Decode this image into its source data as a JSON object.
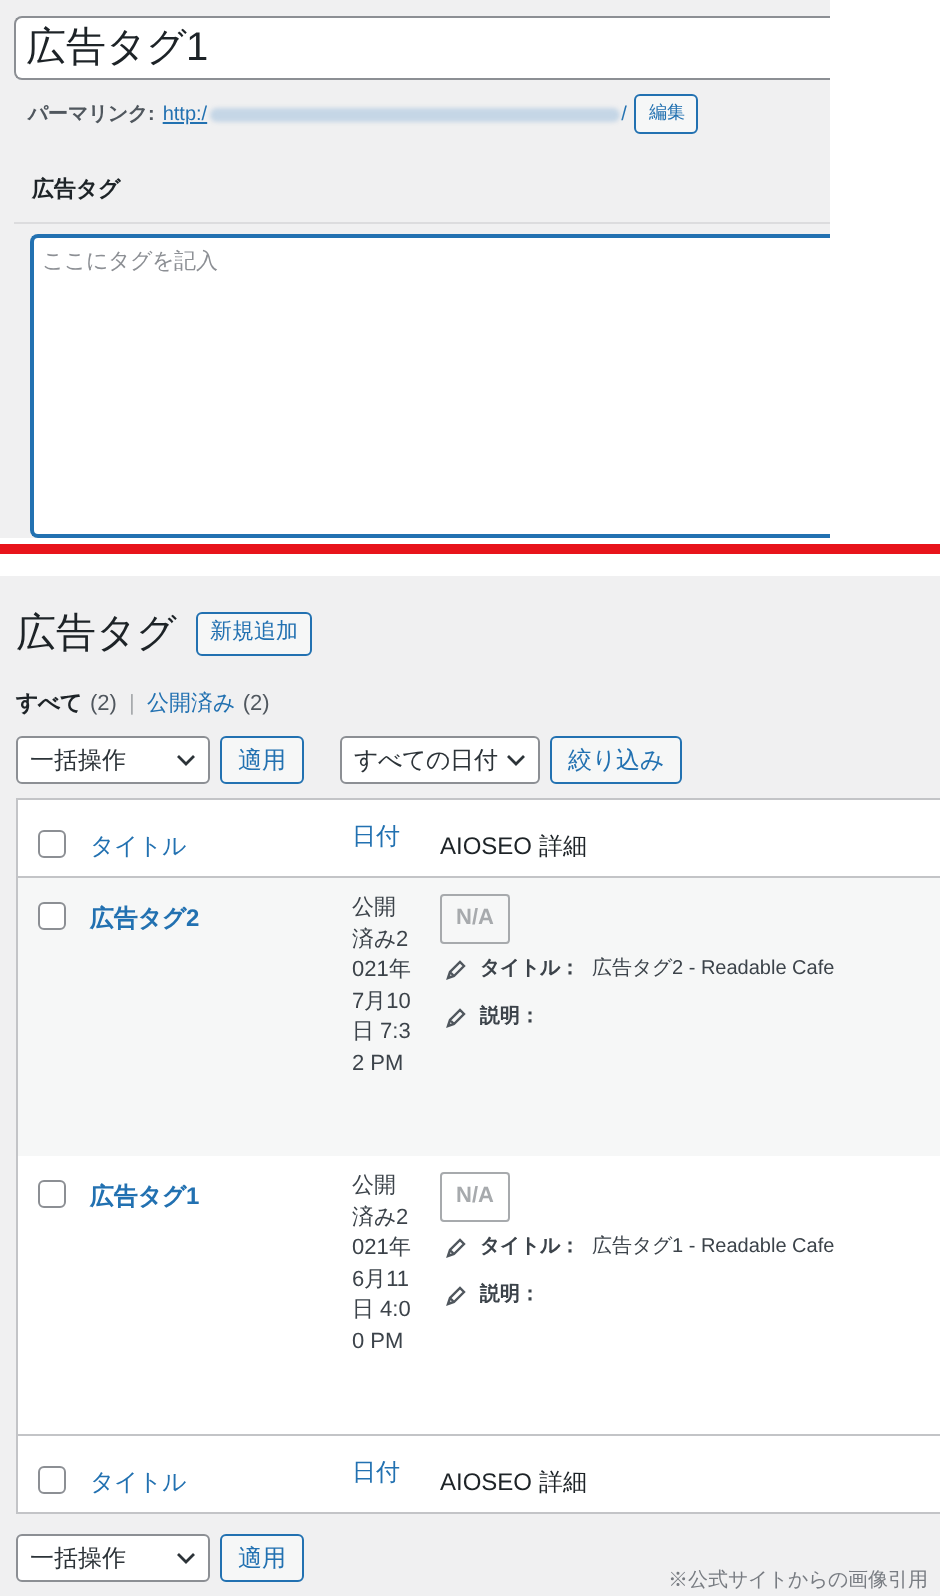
{
  "editor": {
    "title_value": "広告タグ1",
    "permalink_label": "パーマリンク:",
    "permalink_url": "http:/",
    "permalink_end": "/",
    "edit_button": "編集",
    "tag_label": "広告タグ",
    "tag_placeholder": "ここにタグを記入"
  },
  "list": {
    "heading": "広告タグ",
    "add_new": "新規追加",
    "filters": [
      {
        "label": "すべて",
        "count": "(2)",
        "selected": true
      },
      {
        "label": "公開済み",
        "count": "(2)",
        "selected": false
      }
    ],
    "filter_separator": "|",
    "bulk_action": "一括操作",
    "apply": "適用",
    "date_filter": "すべての日付",
    "filter_button": "絞り込み",
    "header": {
      "checked": false,
      "columns": [
        {
          "label": "タイトル",
          "kind": "sortable"
        },
        {
          "label": "日付",
          "kind": "sortable"
        },
        {
          "label": "AIOSEO 詳細",
          "kind": "plain"
        }
      ]
    },
    "rows": [
      {
        "checked": false,
        "title": "広告タグ2",
        "date": "公開済み2021年7月10日 7:32 PM",
        "seo_badge": "N/A",
        "seo_title_label": "タイトル：",
        "seo_title": "広告タグ2 - Readable Cafe",
        "seo_desc_label": "説明："
      },
      {
        "checked": false,
        "title": "広告タグ1",
        "date": "公開済み2021年6月11日 4:00 PM",
        "seo_badge": "N/A",
        "seo_title_label": "タイトル：",
        "seo_title": "広告タグ1 - Readable Cafe",
        "seo_desc_label": "説明："
      }
    ],
    "footer": {
      "checked": false,
      "columns": [
        {
          "label": "タイトル",
          "kind": "sortable"
        },
        {
          "label": "日付",
          "kind": "sortable"
        },
        {
          "label": "AIOSEO 詳細",
          "kind": "plain"
        }
      ]
    },
    "bottom_bulk_action": "一括操作",
    "bottom_apply": "適用"
  },
  "caption": "※公式サイトからの画像引用"
}
